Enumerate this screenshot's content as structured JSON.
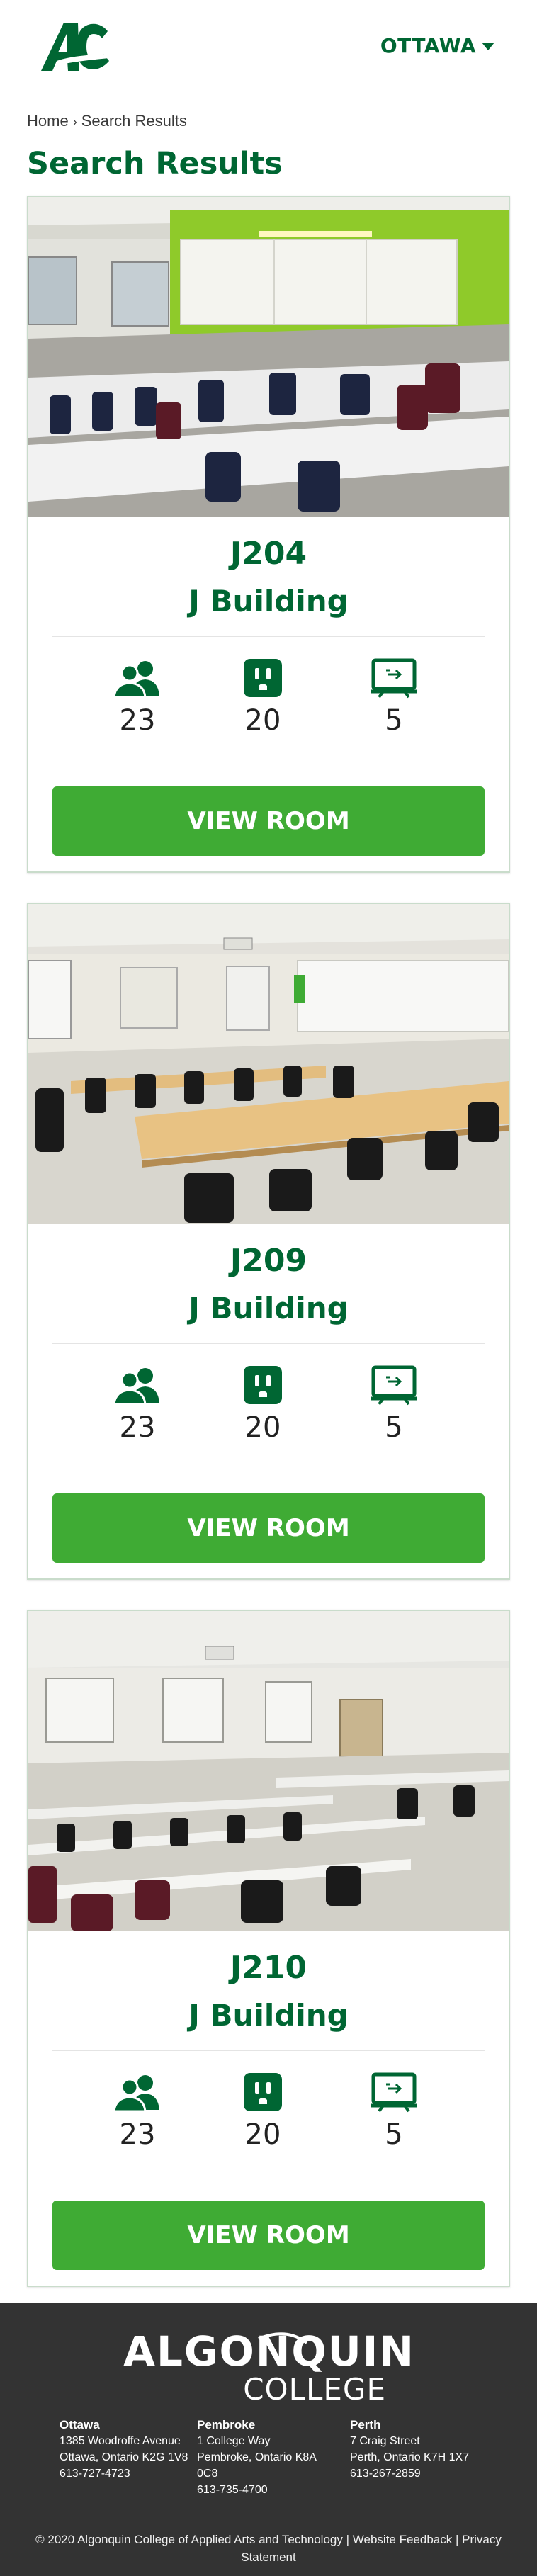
{
  "header": {
    "logo_alt": "AC",
    "campus_selector": "OTTAWA"
  },
  "breadcrumb": {
    "home": "Home",
    "current": "Search Results"
  },
  "page_title": "Search Results",
  "rooms": [
    {
      "code": "J204",
      "building": "J Building",
      "capacity": "23",
      "power_outlets": "20",
      "displays": "5",
      "button": "VIEW ROOM"
    },
    {
      "code": "J209",
      "building": "J Building",
      "capacity": "23",
      "power_outlets": "20",
      "displays": "5",
      "button": "VIEW ROOM"
    },
    {
      "code": "J210",
      "building": "J Building",
      "capacity": "23",
      "power_outlets": "20",
      "displays": "5",
      "button": "VIEW ROOM"
    }
  ],
  "icons": {
    "capacity": "people-icon",
    "power": "power-outlet-icon",
    "display": "projector-screen-icon"
  },
  "footer": {
    "logo_line1": "ALGONQUIN",
    "logo_line2": "COLLEGE",
    "campuses": [
      {
        "name": "Ottawa",
        "line1": "1385 Woodroffe Avenue",
        "line2": "Ottawa, Ontario K2G 1V8",
        "line3": "613-727-4723",
        "line4": ""
      },
      {
        "name": "Pembroke",
        "line1": "1 College Way",
        "line2": "Pembroke, Ontario K8A",
        "line3": "0C8",
        "line4": "613-735-4700"
      },
      {
        "name": "Perth",
        "line1": "7 Craig Street",
        "line2": "Perth, Ontario K7H 1X7",
        "line3": "613-267-2859",
        "line4": ""
      }
    ],
    "copyright": "© 2020 Algonquin College of Applied Arts and Technology",
    "sep": "|",
    "website_feedback": "Website Feedback",
    "privacy": "Privacy Statement"
  },
  "colors": {
    "brand_green": "#006633",
    "button_green": "#3fab34",
    "footer_bg": "#333333"
  }
}
